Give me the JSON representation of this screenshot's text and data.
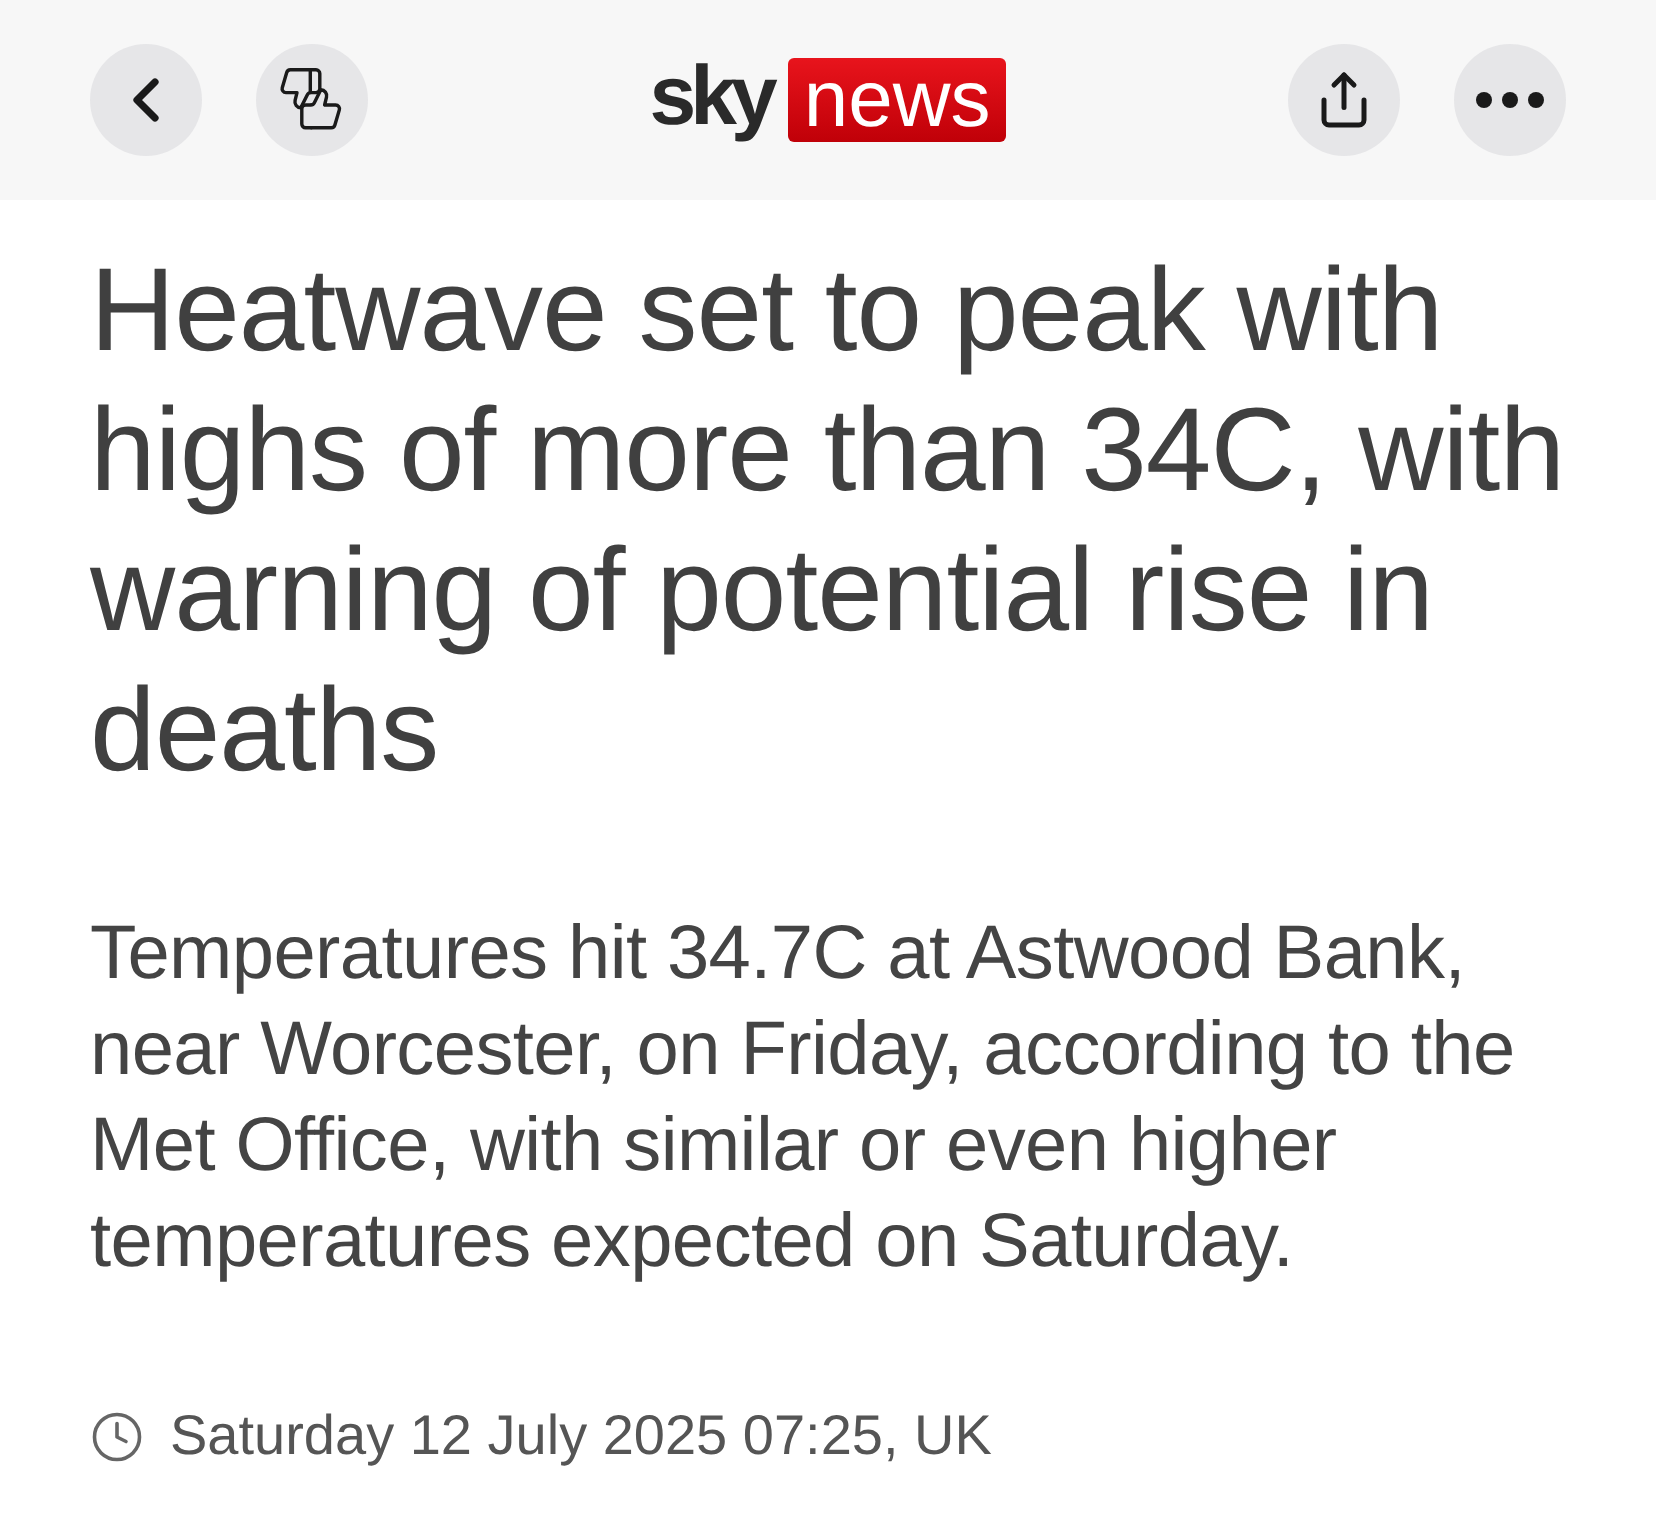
{
  "header": {
    "logo": {
      "wordmark": "sky",
      "badge": "news"
    }
  },
  "article": {
    "headline": "Heatwave set to peak with highs of more than 34C, with warning of potential rise in deaths",
    "summary": "Temperatures hit 34.7C at Astwood Bank, near Worcester, on Friday, according to the Met Office, with similar or even higher temperatures expected on Saturday.",
    "timestamp": "Saturday 12 July 2025 07:25, UK"
  }
}
